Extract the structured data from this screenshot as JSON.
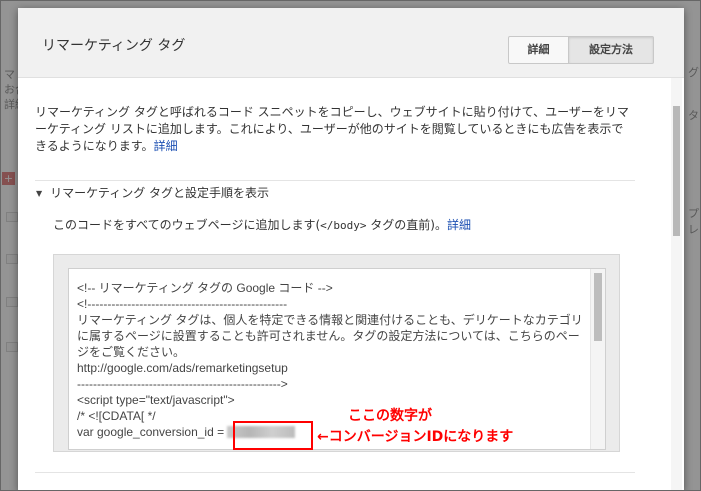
{
  "background": {
    "left_fragments": [
      "マ",
      "お合",
      "詳細"
    ],
    "right_fragments": [
      "グ",
      "タ",
      "プレ"
    ],
    "top_fragment": "グ"
  },
  "dialog": {
    "title": "リマーケティング タグ",
    "buttons": {
      "details": "詳細",
      "setup": "設定方法"
    },
    "intro_text": "リマーケティング タグと呼ばれるコード スニペットをコピーし、ウェブサイトに貼り付けて、ユーザーをリマーケティング リストに追加します。これにより、ユーザーが他のサイトを閲覧しているときにも広告を表示できるようになります。",
    "intro_link": "詳細",
    "section_title": "リマーケティング タグと設定手順を表示",
    "instruction_before": "このコードをすべてのウェブページに追加します(",
    "instruction_code": "</body>",
    "instruction_after": " タグの直前)。",
    "instruction_link": "詳細",
    "code": {
      "line1": "<!-- リマーケティング タグの Google コード -->",
      "line2": "<!--------------------------------------------------",
      "line3": "リマーケティング タグは、個人を特定できる情報と関連付けることも、デリケートなカテゴリに属するページに設置することも許可されません。タグの設定方法については、こちらのページをご覧ください。",
      "line4": "http://google.com/ads/remarketingsetup",
      "line5": "--------------------------------------------------->",
      "line6": "<script type=\"text/javascript\">",
      "line7": "/* <![CDATA[ */",
      "line8": "var google_conversion_id ="
    }
  },
  "annotation": {
    "line1": "ここの数字が",
    "line2": "←コンバージョンIDになります",
    "color": "#ff0000"
  }
}
